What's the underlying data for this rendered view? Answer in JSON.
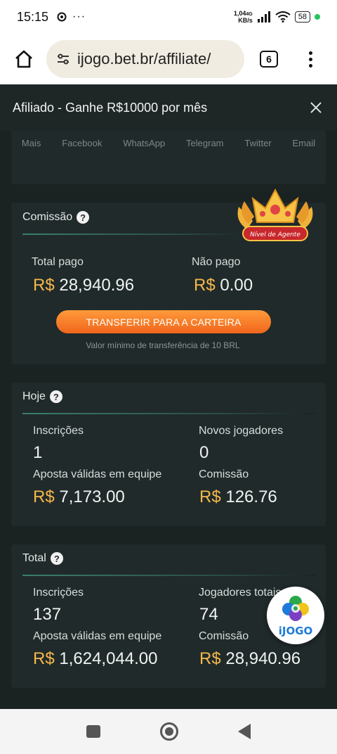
{
  "status_bar": {
    "time": "15:15",
    "net_speed_top": "1,04",
    "net_speed_unit": "KB/s",
    "net_type": "4G",
    "battery": "58"
  },
  "browser": {
    "url": "ijogo.bet.br/affiliate/",
    "tab_count": "6"
  },
  "header": {
    "title": "Afiliado - Ganhe R$10000 por mês"
  },
  "share": {
    "items": [
      "Mais",
      "Facebook",
      "WhatsApp",
      "Telegram",
      "Twitter",
      "Email"
    ]
  },
  "commission": {
    "title": "Comissão",
    "badge_text": "Nível de Agente",
    "total_paid_label": "Total pago",
    "total_paid_currency": "R$",
    "total_paid_value": "28,940.96",
    "unpaid_label": "Não pago",
    "unpaid_currency": "R$",
    "unpaid_value": "0.00",
    "transfer_button": "TRANSFERIR PARA A CARTEIRA",
    "min_transfer_hint": "Valor mínimo de transferência de 10 BRL"
  },
  "today": {
    "title": "Hoje",
    "signups_label": "Inscrições",
    "signups_value": "1",
    "new_players_label": "Novos jogadores",
    "new_players_value": "0",
    "valid_bets_label": "Aposta válidas em equipe",
    "valid_bets_currency": "R$",
    "valid_bets_value": "7,173.00",
    "commission_label": "Comissão",
    "commission_currency": "R$",
    "commission_value": "126.76"
  },
  "total": {
    "title": "Total",
    "signups_label": "Inscrições",
    "signups_value": "137",
    "players_label": "Jogadores totais",
    "players_value": "74",
    "valid_bets_label": "Aposta válidas em equipe",
    "valid_bets_currency": "R$",
    "valid_bets_value": "1,624,044.00",
    "commission_label": "Comissão",
    "commission_currency": "R$",
    "commission_value": "28,940.96"
  },
  "fab": {
    "logo_text": "iJOGO"
  },
  "colors": {
    "background": "#1a2222",
    "card": "#202a2a",
    "currency": "#f5b84a",
    "button": "#f0661c"
  }
}
